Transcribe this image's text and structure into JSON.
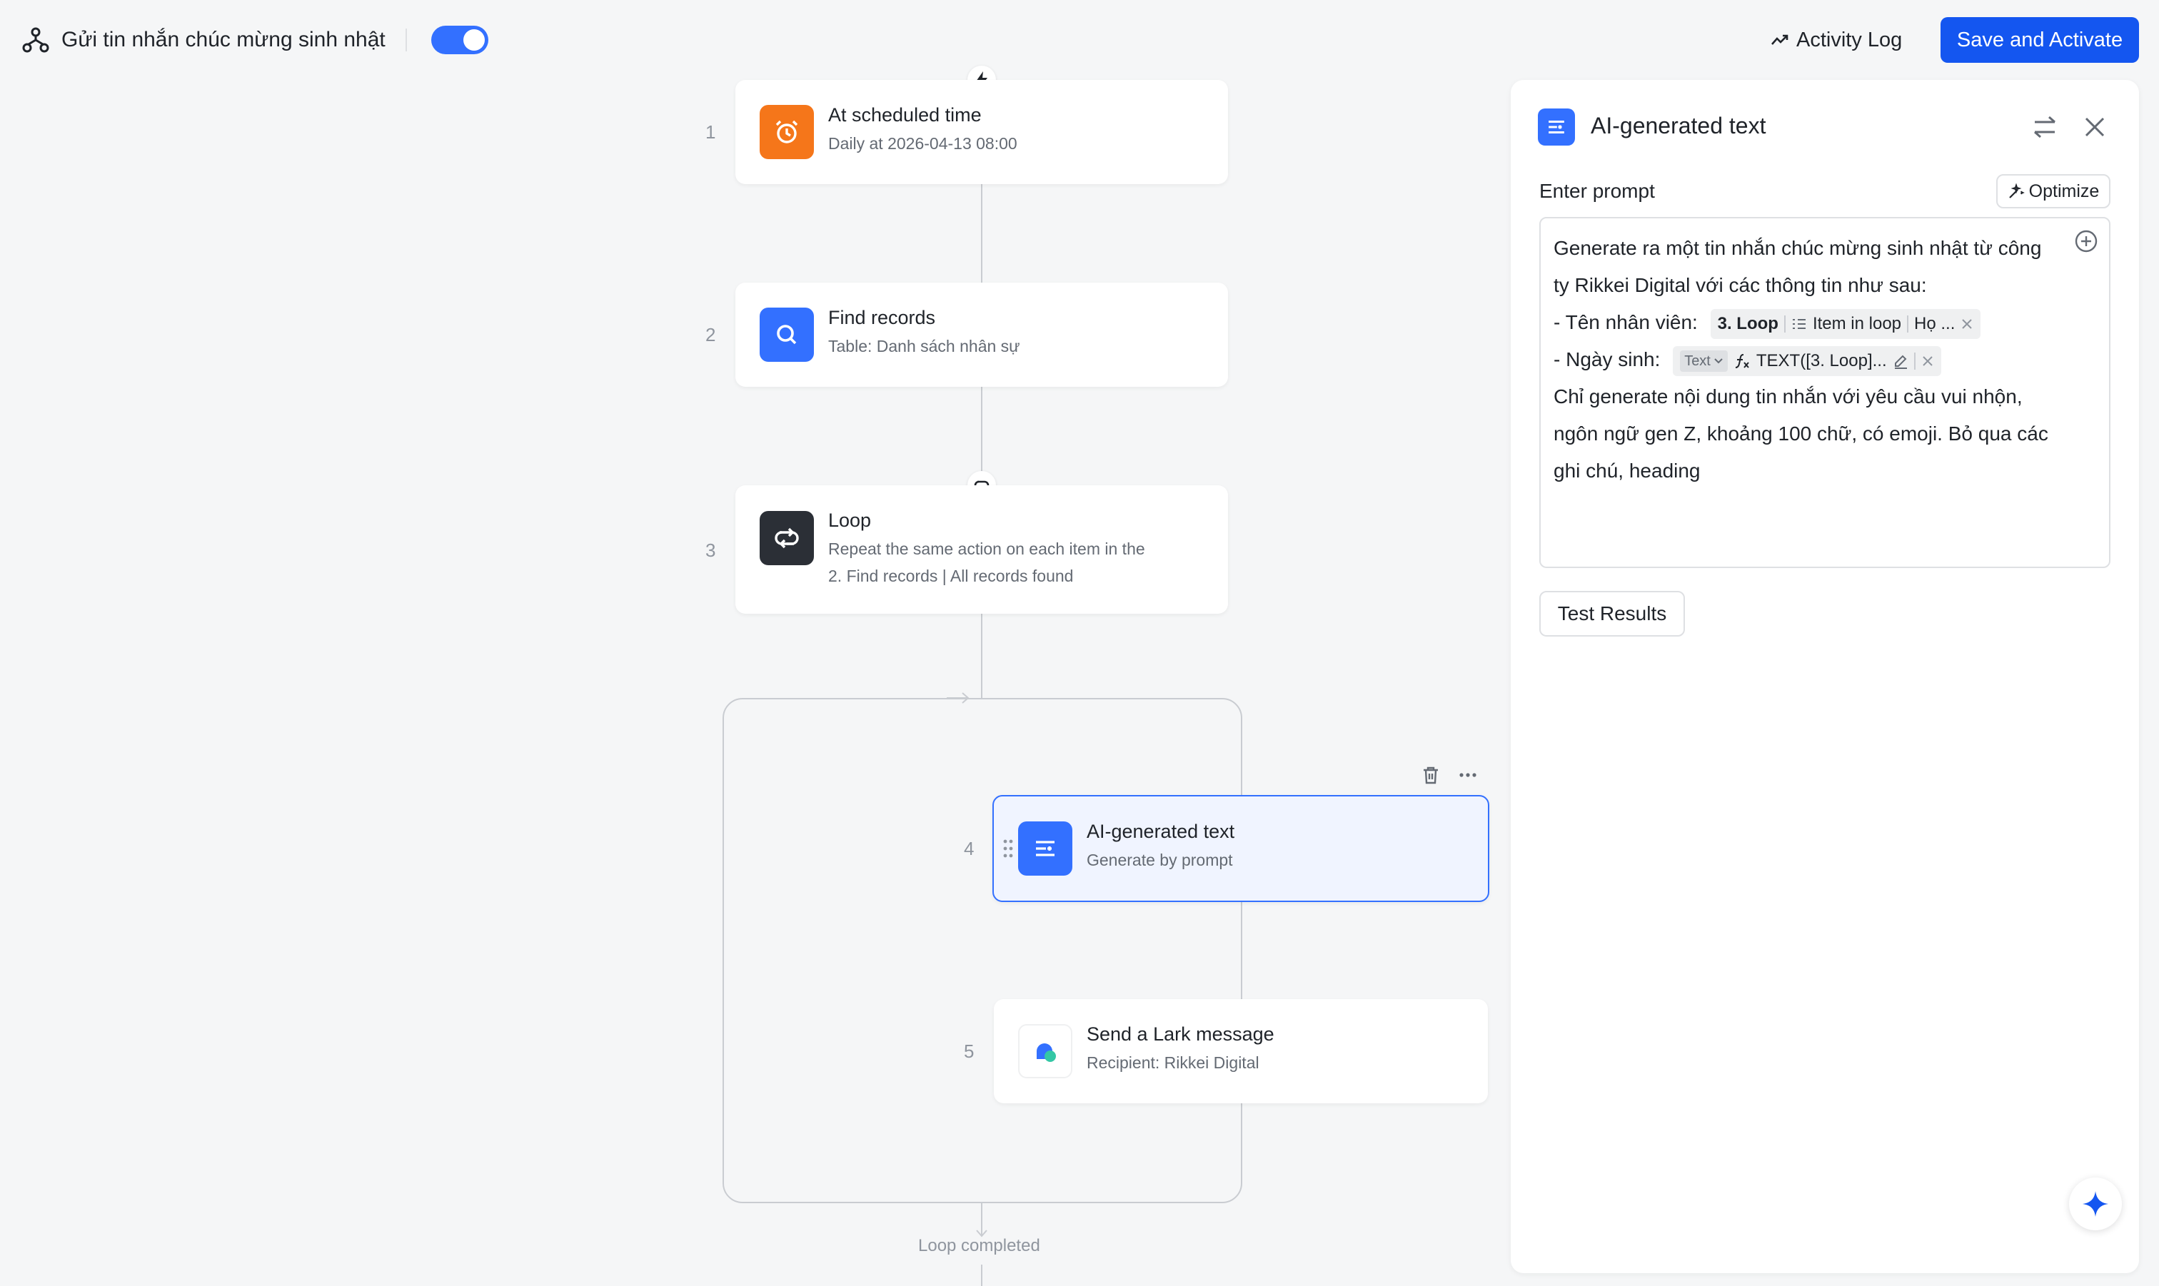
{
  "header": {
    "workflow_title": "Gửi tin nhắn chúc mừng sinh nhật",
    "enabled": true,
    "activity_log_label": "Activity Log",
    "save_label": "Save and Activate"
  },
  "colors": {
    "accent": "#3370ff",
    "primary_button": "#1456f0",
    "trigger_orange": "#f5761a",
    "loop_dark": "#2b2f36"
  },
  "steps": [
    {
      "number": "1",
      "title": "At scheduled time",
      "subtitle": "Daily at 2026-04-13 08:00",
      "icon": "alarm-clock-icon"
    },
    {
      "number": "2",
      "title": "Find records",
      "subtitle": "Table: Danh sách nhân sự",
      "icon": "search-icon"
    },
    {
      "number": "3",
      "title": "Loop",
      "subtitle_line1": "Repeat the same action on each item in the",
      "subtitle_line2": "2. Find records | All records found",
      "icon": "loop-icon"
    },
    {
      "number": "4",
      "title": "AI-generated text",
      "subtitle": "Generate by prompt",
      "icon": "ai-text-icon"
    },
    {
      "number": "5",
      "title": "Send a Lark message",
      "subtitle": "Recipient: Rikkei Digital",
      "icon": "lark-message-icon"
    }
  ],
  "loop_completed_label": "Loop completed",
  "panel": {
    "title": "AI-generated text",
    "prompt_label": "Enter prompt",
    "optimize_label": "Optimize",
    "prompt": {
      "line1": "Generate ra một tin nhắn chúc mừng sinh nhật từ công",
      "line2": "ty Rikkei Digital với các thông tin như sau:",
      "line3_prefix": "- Tên nhân viên:",
      "token1": {
        "source": "3. Loop",
        "item": "Item in loop",
        "field": "Họ ..."
      },
      "line4_prefix": "- Ngày sinh:",
      "token2": {
        "type": "Text",
        "formula": "TEXT([3. Loop]..."
      },
      "line5": "Chỉ generate nội dung tin nhắn với yêu cầu vui nhộn,",
      "line6": "ngôn ngữ gen Z, khoảng 100 chữ, có emoji. Bỏ qua các",
      "line7": "ghi chú, heading"
    },
    "test_results_label": "Test Results"
  }
}
